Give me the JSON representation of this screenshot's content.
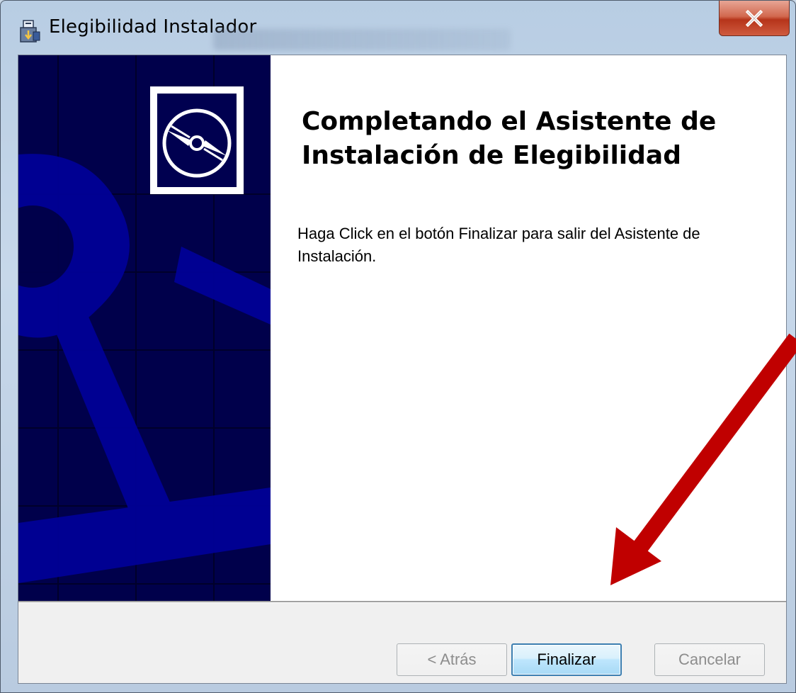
{
  "window": {
    "title": "Elegibilidad Instalador",
    "app_icon": "installer-icon",
    "close_icon": "close-icon"
  },
  "banner": {
    "logo_icon": "cd-disc-icon",
    "background_icon": "anchor-wheel-icon"
  },
  "content": {
    "heading": "Completando el Asistente de Instalación de Elegibilidad",
    "body": "Haga Click en el botón Finalizar para salir del Asistente de Instalación."
  },
  "buttons": {
    "back": "< Atrás",
    "finish": "Finalizar",
    "cancel": "Cancelar"
  },
  "colors": {
    "banner_bg": "#00004b",
    "banner_shape": "#000096",
    "arrow": "#c00000",
    "default_button_border": "#3c7fb1"
  },
  "annotation": {
    "arrow_icon": "red-arrow-pointing-to-finalizar"
  }
}
